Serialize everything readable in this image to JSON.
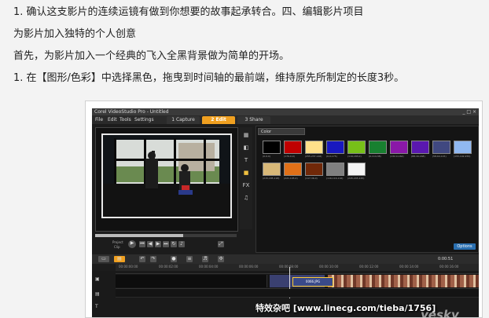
{
  "article": {
    "p1": "1. 确认这支影片的连续运镜有做到你想要的故事起承转合。四、编辑影片项目",
    "p2": "为影片加入独特的个人创意",
    "p3": "首先，为影片加入一个经典的飞入全黑背景做为简单的开场。",
    "p4": "1. 在【图形/色彩】中选择黑色，拖曳到时间轴的最前端，维持原先所制定的长度3秒。"
  },
  "app": {
    "title": "Corel VideoStudio Pro - Untitled",
    "menu": [
      "File",
      "Edit",
      "Tools",
      "Settings"
    ],
    "steps": [
      {
        "num": "1",
        "label": "Capture",
        "active": false
      },
      {
        "num": "2",
        "label": "Edit",
        "active": true
      },
      {
        "num": "3",
        "label": "Share",
        "active": false
      }
    ],
    "window_controls": "_ □ ×",
    "preview": {
      "project_label": "Project",
      "clip_label": "Clip"
    },
    "library": {
      "category": "Color",
      "options_label": "Options",
      "swatches": [
        {
          "color": "#000000",
          "label": "(0,0,0)"
        },
        {
          "color": "#c00000",
          "label": "(176,0,0)"
        },
        {
          "color": "#ffe08a",
          "label": "(255,237,146)"
        },
        {
          "color": "#1818c0",
          "label": "(0,0,175)"
        },
        {
          "color": "#77c018",
          "label": "(119,183,0)"
        },
        {
          "color": "#188030",
          "label": "(0,114,38)"
        },
        {
          "color": "#8a18a8",
          "label": "(132,0,164)"
        },
        {
          "color": "#5a18b0",
          "label": "(88,16,168)"
        },
        {
          "color": "#404880",
          "label": "(58,64,115)"
        },
        {
          "color": "#90b8f0",
          "label": "(155,192,255)"
        },
        {
          "color": "#d8b878",
          "label": "(215,185,118)"
        },
        {
          "color": "#e07018",
          "label": "(221,105,0)"
        },
        {
          "color": "#702808",
          "label": "(117,36,0)"
        },
        {
          "color": "#808080",
          "label": "(116,116,116)"
        },
        {
          "color": "#f4f4f4",
          "label": "(245,245,245)"
        }
      ]
    },
    "timeline": {
      "ruler_ticks": [
        "00:00:00:00",
        "00:00:02:00",
        "00:00:04:00",
        "00:00:06:00",
        "00:00:08:00",
        "00:00:10:00",
        "00:00:12:00",
        "00:00:14:00",
        "00:00:16:00"
      ],
      "timecode": "0:00:51",
      "clip_name": "0066.JPG"
    }
  },
  "watermark": "特效杂吧 [www.linecg.com/tieba/1756]",
  "logo": "yesky"
}
